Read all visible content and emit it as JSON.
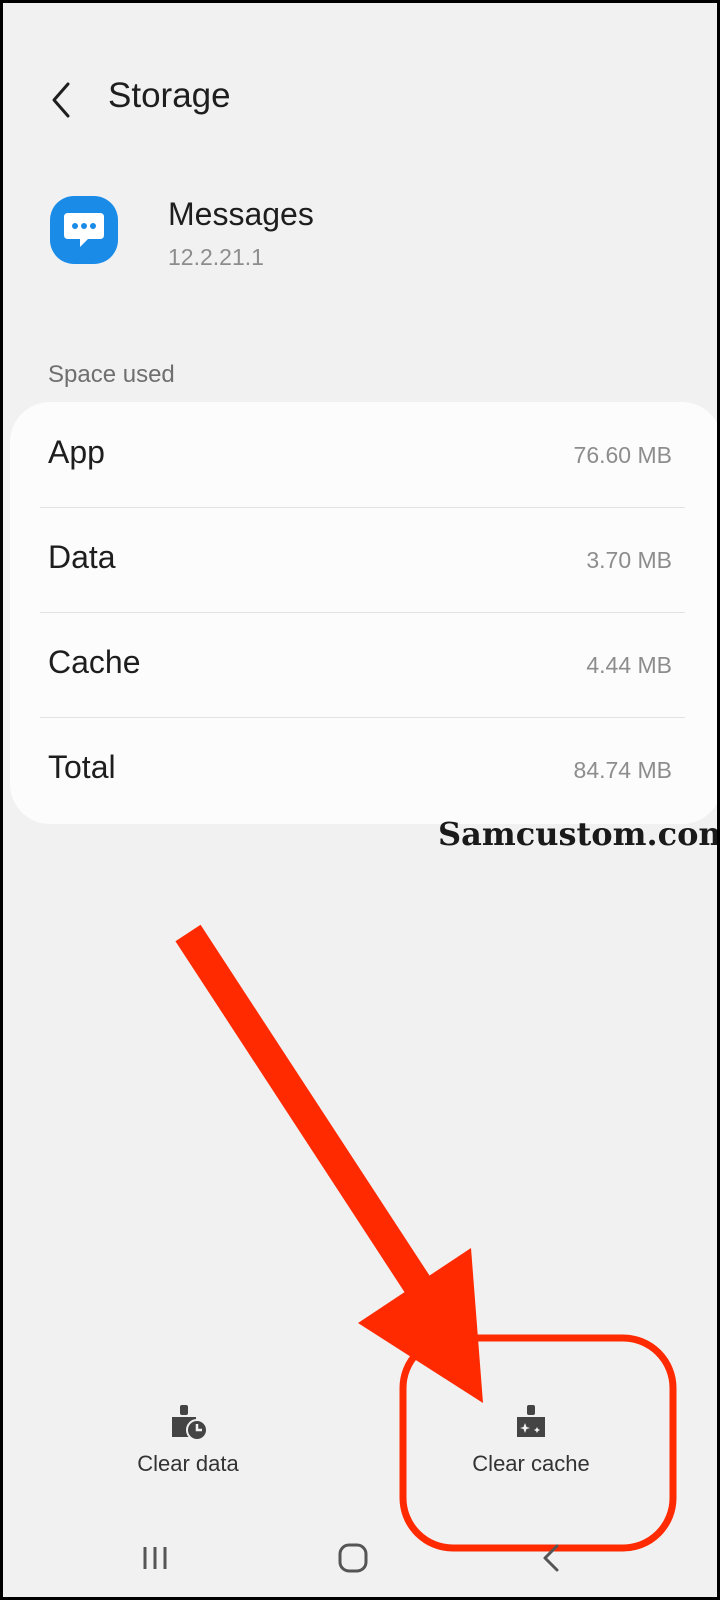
{
  "header": {
    "title": "Storage",
    "back_icon": "chevron-left-icon"
  },
  "app": {
    "name": "Messages",
    "version": "12.2.21.1",
    "icon": "chat-bubble-icon",
    "icon_color": "#1a8ce8"
  },
  "space_used": {
    "label": "Space used",
    "rows": [
      {
        "label": "App",
        "value": "76.60 MB"
      },
      {
        "label": "Data",
        "value": "3.70 MB"
      },
      {
        "label": "Cache",
        "value": "4.44 MB"
      },
      {
        "label": "Total",
        "value": "84.74 MB"
      }
    ]
  },
  "watermark": "Samcustom.com",
  "actions": {
    "clear_data": {
      "label": "Clear data",
      "icon": "broom-clock-icon"
    },
    "clear_cache": {
      "label": "Clear cache",
      "icon": "broom-sparkle-icon"
    }
  },
  "navbar": {
    "recents_icon": "recents-icon",
    "home_icon": "home-icon",
    "back_icon": "back-icon"
  },
  "annotation": {
    "color": "#ff2a00"
  }
}
